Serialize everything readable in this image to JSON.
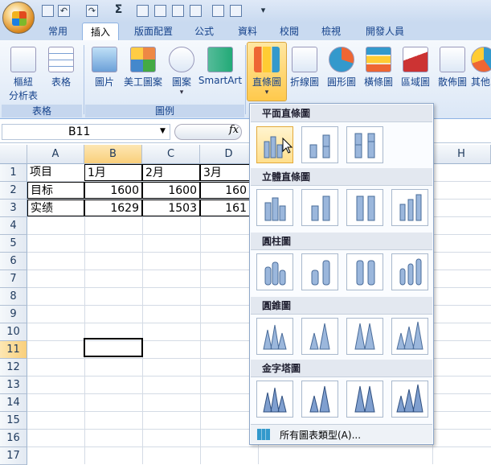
{
  "quick_access": {
    "icons": [
      "save-icon",
      "undo-icon",
      "redo-icon",
      "sum-icon",
      "sort-icon",
      "filter-icon",
      "format-icon",
      "table-icon",
      "columns-icon",
      "print-preview-icon",
      "customize-icon"
    ],
    "sum_symbol": "Σ"
  },
  "tabs": [
    {
      "label": "常用"
    },
    {
      "label": "插入"
    },
    {
      "label": "版面配置"
    },
    {
      "label": "公式"
    },
    {
      "label": "資料"
    },
    {
      "label": "校閱"
    },
    {
      "label": "檢視"
    },
    {
      "label": "開發人員"
    }
  ],
  "ribbon": {
    "pivot": {
      "line1": "樞紐",
      "line2": "分析表"
    },
    "table": {
      "label": "表格"
    },
    "group_tables": "表格",
    "picture": {
      "label": "圖片"
    },
    "clipart": {
      "label": "美工圖案"
    },
    "shapes": {
      "label": "圖案"
    },
    "smartart": {
      "label": "SmartArt"
    },
    "group_illustrations": "圖例",
    "charts": [
      {
        "label": "直條圖"
      },
      {
        "label": "折線圖"
      },
      {
        "label": "圓形圖"
      },
      {
        "label": "橫條圖"
      },
      {
        "label": "區域圖"
      },
      {
        "label": "散佈圖"
      },
      {
        "label": "其他圖表"
      }
    ]
  },
  "formula_bar": {
    "name_box": "B11",
    "fx_label": "fx"
  },
  "sheet": {
    "columns": [
      "A",
      "B",
      "C",
      "D",
      "H"
    ],
    "rows": [
      "1",
      "2",
      "3",
      "4",
      "5",
      "6",
      "7",
      "8",
      "9",
      "10",
      "11",
      "12",
      "13",
      "14",
      "15",
      "16",
      "17"
    ],
    "cells": {
      "A1": "项目",
      "B1": "1月",
      "C1": "2月",
      "D1": "3月",
      "A2": "目标",
      "B2": "1600",
      "C2": "1600",
      "D2": "160",
      "A3": "实绩",
      "B3": "1629",
      "C3": "1503",
      "D3": "161"
    },
    "active_cell": "B11"
  },
  "chart_menu": {
    "sections": [
      {
        "title": "平面直條圖"
      },
      {
        "title": "立體直條圖"
      },
      {
        "title": "圓柱圖"
      },
      {
        "title": "圓錐圖"
      },
      {
        "title": "金字塔圖"
      }
    ],
    "all_types": "所有圖表類型(A)..."
  },
  "colors": {
    "accent": "#15428b",
    "ribbon_bg": "#dbe7f6",
    "selected_header": "#f9cf7b",
    "hover": "#ffdf8d"
  }
}
